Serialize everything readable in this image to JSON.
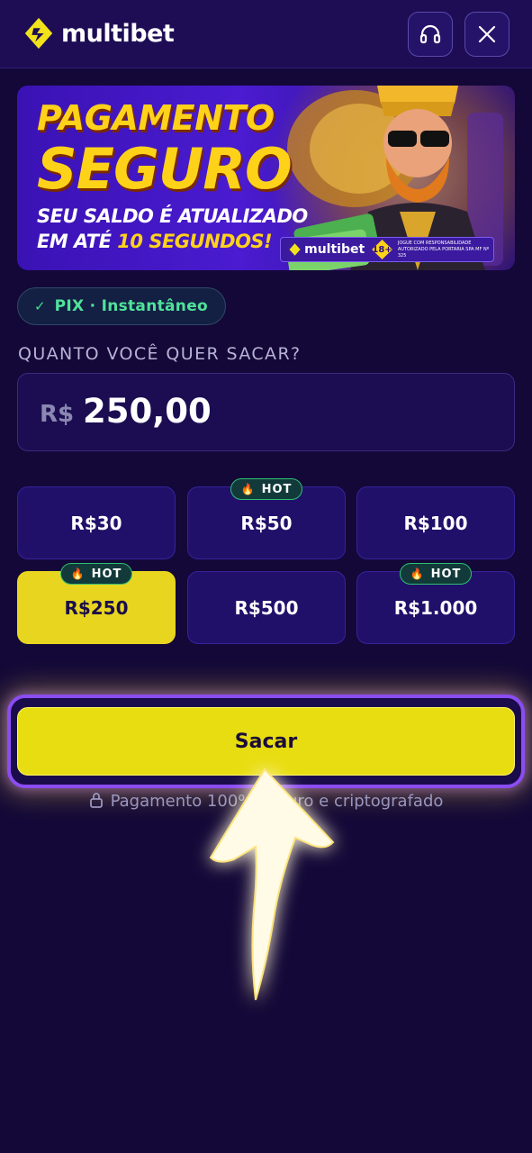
{
  "header": {
    "brand": "multibet",
    "support_icon": "headphones-icon",
    "close_icon": "close-icon",
    "accent": "#f2e21a"
  },
  "banner": {
    "line1": "PAGAMENTO",
    "line2": "SEGURO",
    "line3": "SEU SALDO É ATUALIZADO",
    "line4_prefix": "EM ATÉ ",
    "line4_highlight": "10 SEGUNDOS!",
    "badge_brand": "multibet",
    "badge_age": "18+",
    "badge_small_1": "JOGUE COM RESPONSABILIDADE",
    "badge_small_2": "AUTORIZADO PELA PORTARIA SPA MF Nº 325"
  },
  "method": {
    "label": "PIX · Instantâneo",
    "check_icon": "checkmark-icon"
  },
  "withdraw": {
    "question": "QUANTO VOCÊ QUER SACAR?",
    "currency": "R$",
    "amount": "250,00"
  },
  "presets": [
    {
      "label": "R$30",
      "hot": false,
      "selected": false
    },
    {
      "label": "R$50",
      "hot": true,
      "selected": false
    },
    {
      "label": "R$100",
      "hot": false,
      "selected": false
    },
    {
      "label": "R$250",
      "hot": true,
      "selected": true
    },
    {
      "label": "R$500",
      "hot": false,
      "selected": false
    },
    {
      "label": "R$1.000",
      "hot": true,
      "selected": false
    }
  ],
  "hot_label": "HOT",
  "submit": {
    "label": "Sacar"
  },
  "secure_note": "Pagamento 100% seguro e criptografado",
  "colors": {
    "background": "#130838",
    "button_yellow": "#e8dd10",
    "hot_border": "#2fbf73",
    "highlight_border": "#8b4cf2"
  }
}
